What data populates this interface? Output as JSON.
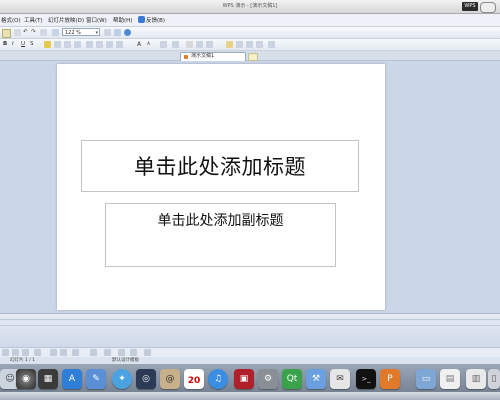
{
  "window": {
    "title": "WPS 演示 - [演示文稿1]",
    "badge": "WPS"
  },
  "menubar": {
    "items": [
      {
        "label": "格式(O)",
        "name": "menu-format"
      },
      {
        "label": "工具(T)",
        "name": "menu-tools"
      },
      {
        "label": "幻灯片放映(D)",
        "name": "menu-slideshow"
      },
      {
        "label": "窗口(W)",
        "name": "menu-window"
      },
      {
        "label": "帮助(H)",
        "name": "menu-help"
      },
      {
        "label": "反馈(B)",
        "name": "menu-feedback"
      }
    ]
  },
  "toolbar": {
    "zoom_value": "122 %",
    "bold_label": "B",
    "italic_label": "I",
    "underline_label": "U",
    "shadow_label": "S",
    "font_grow_label": "A",
    "font_shrink_label": "A"
  },
  "tabs": {
    "document_tab": "演示文稿1"
  },
  "slide": {
    "title_placeholder": "单击此处添加标题",
    "subtitle_placeholder": "单击此处添加副标题"
  },
  "statusbar": {
    "slide_counter": "幻灯片 1 / 1",
    "design_template": "默认设计模板"
  },
  "dock": {
    "calendar_day": "20"
  },
  "colors": {
    "workspace_bg": "#cbd6e8",
    "slide_bg": "#ffffff",
    "accent_orange": "#e07a2a"
  }
}
